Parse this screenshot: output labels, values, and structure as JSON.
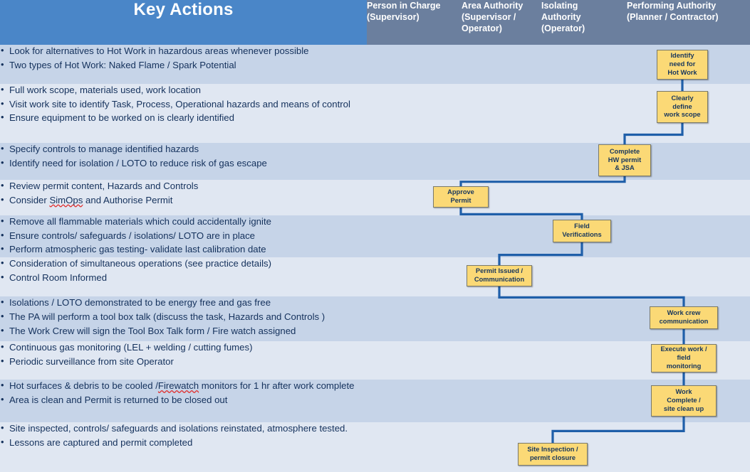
{
  "title": "Hot Work Key Actions and Roles Flow",
  "colors": {
    "header_key_bg": "#4a86c8",
    "header_role_bg": "#6b7f9e",
    "row_odd_bg": "#c6d4e8",
    "row_even_bg": "#e0e7f2",
    "node_fill": "#fbd976",
    "node_border": "#7a7a6a",
    "connector": "#1f5fa9",
    "text": "#17365d"
  },
  "header": {
    "key_actions": "Key Actions",
    "roles": [
      "Person in Charge (Supervisor)",
      "Area Authority (Supervisor / Operator)",
      "Isolating Authority (Operator)",
      "Performing Authority (Planner / Contractor)"
    ],
    "roles_lines": [
      [
        "Person in Charge",
        "(Supervisor)"
      ],
      [
        "Area Authority",
        "(Supervisor /",
        "Operator)"
      ],
      [
        "Isolating",
        "Authority",
        "(Operator)"
      ],
      [
        "Performing Authority",
        "(Planner / Contractor)"
      ]
    ]
  },
  "rows": [
    {
      "id": "row-1",
      "bullets": [
        "Look for alternatives to Hot Work in hazardous areas whenever possible",
        "Two types of Hot Work: Naked Flame / Spark Potential"
      ]
    },
    {
      "id": "row-2",
      "bullets": [
        "Full work scope, materials used, work location",
        "Visit work site to identify Task, Process, Operational hazards and means of control",
        "Ensure equipment to be worked on is clearly identified"
      ]
    },
    {
      "id": "row-3",
      "bullets": [
        "Specify controls to manage identified hazards",
        "Identify need for isolation / LOTO to reduce risk of gas escape"
      ]
    },
    {
      "id": "row-4",
      "bullets": [
        "Review permit content, Hazards and Controls",
        "Consider SimOps and Authorise Permit"
      ],
      "misspelled": [
        "SimOps"
      ]
    },
    {
      "id": "row-5",
      "bullets": [
        "Remove all flammable materials which could accidentally ignite",
        "Ensure controls/ safeguards / isolations/ LOTO are in place",
        "Perform atmospheric gas testing- validate last calibration date"
      ]
    },
    {
      "id": "row-6",
      "bullets": [
        "Consideration of simultaneous operations (see practice details)",
        "Control Room Informed"
      ]
    },
    {
      "id": "row-7",
      "bullets": [
        "Isolations / LOTO demonstrated to be energy free and gas free",
        "The PA will perform a tool box talk (discuss the task, Hazards and Controls )",
        "The Work Crew will sign the Tool Box Talk form / Fire watch assigned"
      ]
    },
    {
      "id": "row-8",
      "bullets": [
        "Continuous gas monitoring (LEL + welding / cutting fumes)",
        "Periodic surveillance from site Operator"
      ]
    },
    {
      "id": "row-9",
      "bullets": [
        "Hot surfaces & debris to be cooled /Firewatch monitors for 1 hr after work complete",
        "Area is clean and Permit is returned to be closed out"
      ],
      "misspelled": [
        "Firewatch"
      ]
    },
    {
      "id": "row-10",
      "bullets": [
        "Site inspected, controls/ safeguards and isolations reinstated, atmosphere tested.",
        "Lessons are captured and permit completed"
      ]
    }
  ],
  "flow": {
    "nodes": [
      {
        "id": "identify-need",
        "lines": [
          "Identify",
          "need for",
          "Hot Work"
        ],
        "lane": "Performing Authority (Planner / Contractor)",
        "row": 1
      },
      {
        "id": "define-scope",
        "lines": [
          "Clearly",
          "define",
          "work scope"
        ],
        "lane": "Performing Authority (Planner / Contractor)",
        "row": 2
      },
      {
        "id": "complete-permit-jsa",
        "lines": [
          "Complete",
          "HW permit",
          "& JSA"
        ],
        "lane": "Isolating Authority (Operator)",
        "row": 3
      },
      {
        "id": "approve-permit",
        "lines": [
          "Approve",
          "Permit"
        ],
        "lane": "Person in Charge (Supervisor)",
        "row": 4
      },
      {
        "id": "field-verifications",
        "lines": [
          "Field",
          "Verifications"
        ],
        "lane": "Isolating Authority (Operator)",
        "row": 5
      },
      {
        "id": "permit-issued",
        "lines": [
          "Permit Issued /",
          "Communication"
        ],
        "lane": "Area Authority (Supervisor / Operator)",
        "row": 6
      },
      {
        "id": "work-crew-comm",
        "lines": [
          "Work crew",
          "communication"
        ],
        "lane": "Performing Authority (Planner / Contractor)",
        "row": 7
      },
      {
        "id": "execute-work",
        "lines": [
          "Execute work /",
          "field",
          "monitoring"
        ],
        "lane": "Performing Authority (Planner / Contractor)",
        "row": 8
      },
      {
        "id": "work-complete",
        "lines": [
          "Work",
          "Complete /",
          "site clean up"
        ],
        "lane": "Performing Authority (Planner / Contractor)",
        "row": 9
      },
      {
        "id": "site-inspection",
        "lines": [
          "Site Inspection /",
          "permit closure"
        ],
        "lane": "Area Authority (Supervisor / Operator)",
        "row": 10
      }
    ],
    "connections": [
      {
        "from": "identify-need",
        "to": "define-scope"
      },
      {
        "from": "define-scope",
        "to": "complete-permit-jsa"
      },
      {
        "from": "complete-permit-jsa",
        "to": "approve-permit"
      },
      {
        "from": "approve-permit",
        "to": "field-verifications"
      },
      {
        "from": "field-verifications",
        "to": "permit-issued"
      },
      {
        "from": "permit-issued",
        "to": "work-crew-comm"
      },
      {
        "from": "work-crew-comm",
        "to": "execute-work"
      },
      {
        "from": "execute-work",
        "to": "work-complete"
      },
      {
        "from": "work-complete",
        "to": "site-inspection"
      }
    ]
  }
}
